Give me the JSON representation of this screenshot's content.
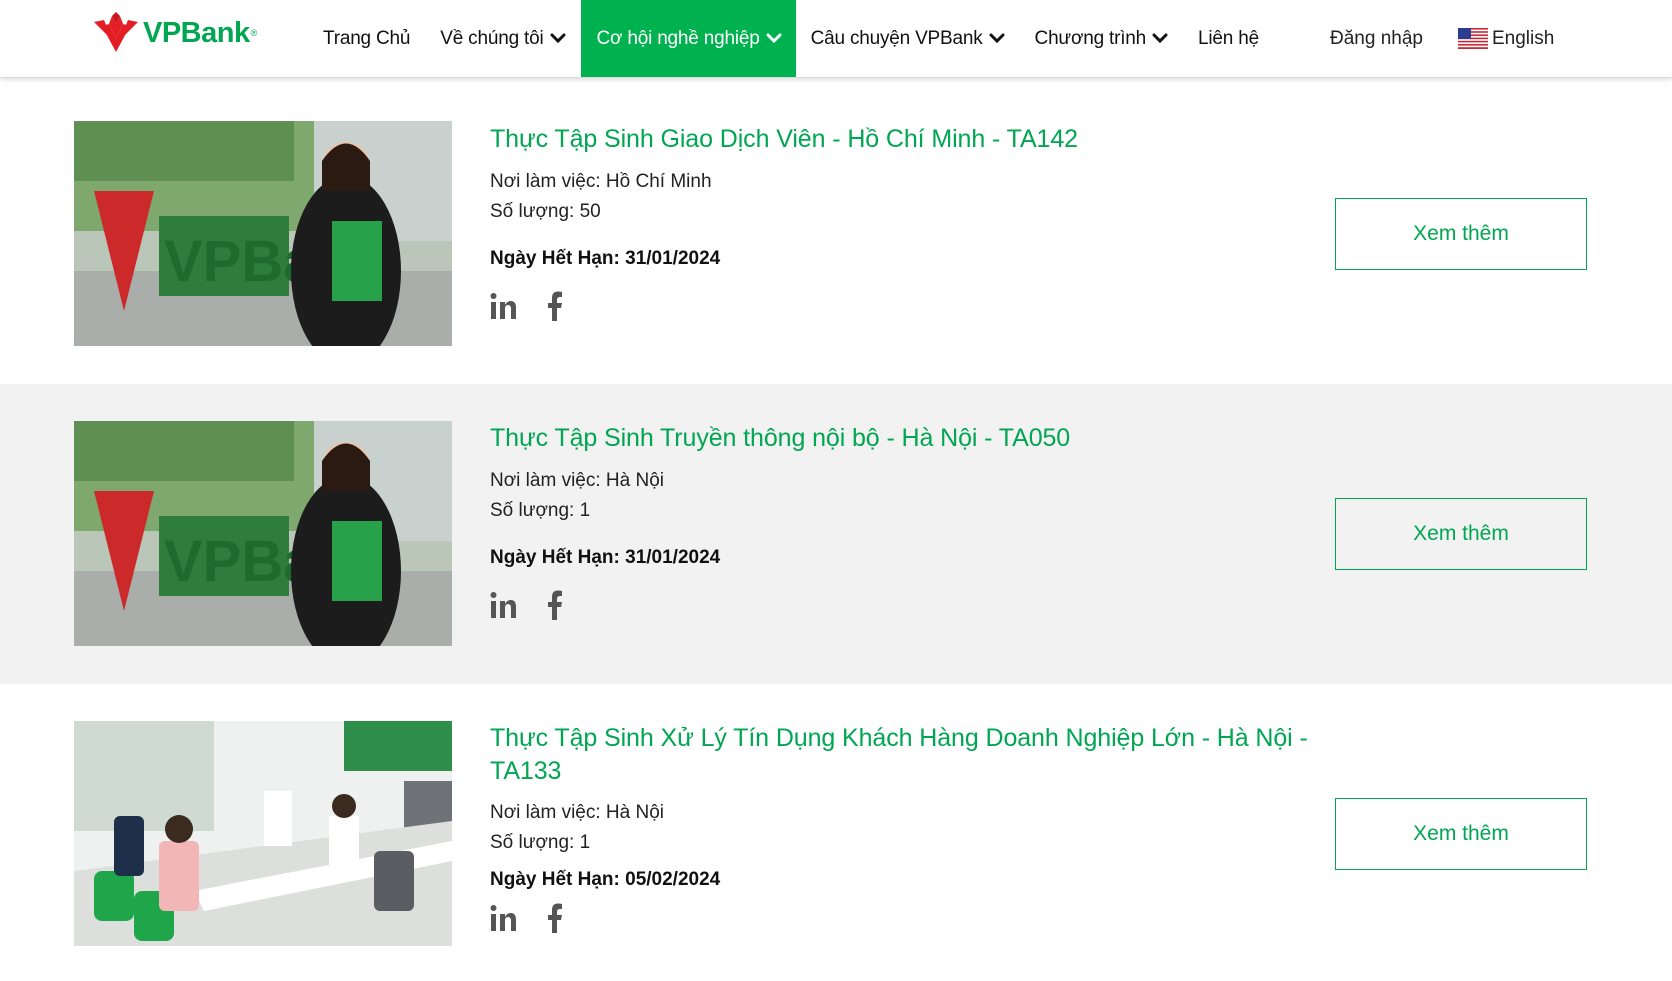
{
  "brand": {
    "name": "VPBank",
    "reg": "®",
    "accent": "#00a651",
    "logo_red": "#e31e24"
  },
  "nav": {
    "items": [
      {
        "label": "Trang Chủ",
        "dropdown": false,
        "active": false
      },
      {
        "label": "Về chúng tôi",
        "dropdown": true,
        "active": false
      },
      {
        "label": "Cơ hội nghề nghiệp",
        "dropdown": true,
        "active": true
      },
      {
        "label": "Câu chuyện VPBank",
        "dropdown": true,
        "active": false
      },
      {
        "label": "Chương trình",
        "dropdown": true,
        "active": false
      },
      {
        "label": "Liên hệ",
        "dropdown": false,
        "active": false
      }
    ],
    "login": "Đăng nhập",
    "language": "English",
    "language_icon": "us-flag-icon"
  },
  "jobs": [
    {
      "title": "Thực Tập Sinh Giao Dịch Viên - Hồ Chí Minh - TA142",
      "location_line": "Nơi làm việc: Hồ Chí Minh",
      "quantity_line": "Số lượng: 50",
      "deadline_line": "Ngày Hết Hạn: 31/01/2024",
      "button": "Xem thêm",
      "image": "vpbank-employee-photo"
    },
    {
      "title": "Thực Tập Sinh Truyền thông nội bộ - Hà Nội - TA050",
      "location_line": "Nơi làm việc: Hà Nội",
      "quantity_line": "Số lượng: 1",
      "deadline_line": "Ngày Hết Hạn: 31/01/2024",
      "button": "Xem thêm",
      "image": "vpbank-employee-photo"
    },
    {
      "title": "Thực Tập Sinh Xử Lý Tín Dụng Khách Hàng Doanh Nghiệp Lớn - Hà Nội - TA133",
      "location_line": "Nơi làm việc: Hà Nội",
      "quantity_line": "Số lượng: 1",
      "deadline_line": "Ngày Hết Hạn: 05/02/2024",
      "button": "Xem thêm",
      "image": "vpbank-branch-counter-photo"
    }
  ],
  "social_icons": [
    "linkedin-icon",
    "facebook-icon"
  ]
}
